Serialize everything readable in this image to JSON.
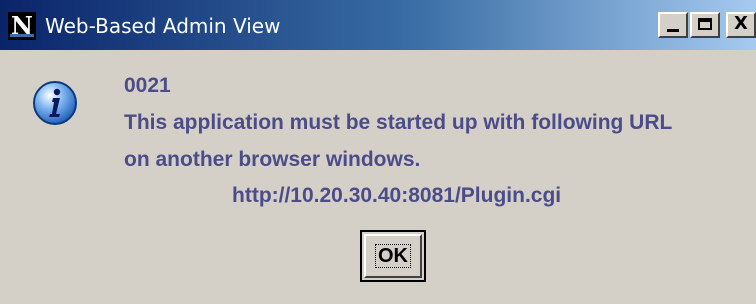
{
  "window": {
    "title": "Web-Based Admin View",
    "app_icon_letter": "N",
    "controls": {
      "minimize_icon": "minimize-icon",
      "maximize_icon": "maximize-icon",
      "close_icon": "close-icon",
      "close_glyph": "X"
    }
  },
  "dialog": {
    "icon": "information-icon",
    "code": "0021",
    "message_line1": "This application must be started up with following URL",
    "message_line2": "on another browser windows.",
    "url": "http://10.20.30.40:8081/Plugin.cgi",
    "ok_label": "OK"
  },
  "colors": {
    "titlebar_start": "#0a246a",
    "titlebar_end": "#a6caf0",
    "message_text": "#4c4c8a",
    "dialog_background": "#d4d0c8"
  }
}
